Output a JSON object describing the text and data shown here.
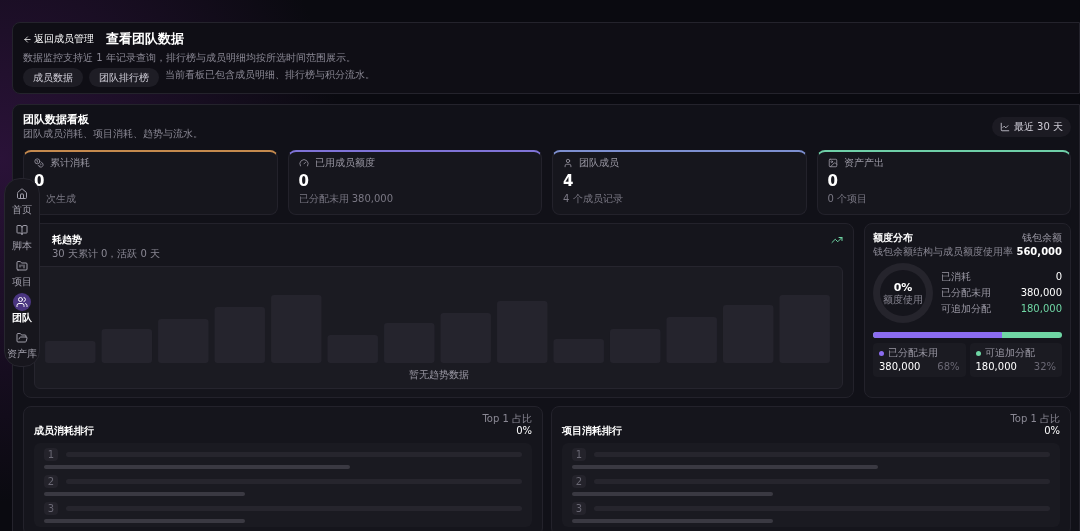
{
  "header": {
    "back_link": "返回成员管理",
    "title": "查看团队数据",
    "description": "数据监控支持近 1 年记录查询，排行榜与成员明细均按所选时间范围展示。",
    "tabs": [
      {
        "label": "成员数据",
        "selected": false
      },
      {
        "label": "团队排行榜",
        "selected": false
      }
    ],
    "note": "当前看板已包含成员明细、排行榜与积分流水。"
  },
  "sidebar": {
    "items": [
      {
        "label": "首页",
        "selected": false
      },
      {
        "label": "脚本",
        "selected": false
      },
      {
        "label": "项目",
        "selected": false
      },
      {
        "label": "团队",
        "selected": true
      },
      {
        "label": "资产库",
        "selected": false
      }
    ]
  },
  "dashboard": {
    "title": "团队数据看板",
    "subtitle": "团队成员消耗、项目消耗、趋势与流水。",
    "range_button": "最近 30 天",
    "stats": [
      {
        "label": "累计消耗",
        "value": "0",
        "detail": "次生成",
        "color": "#c58a4e"
      },
      {
        "label": "已用成员额度",
        "value": "0",
        "detail": "已分配未用 380,000",
        "color": "#7f73d6"
      },
      {
        "label": "团队成员",
        "value": "4",
        "detail": "4 个成员记录",
        "color": "#7d8fd0"
      },
      {
        "label": "资产产出",
        "value": "0",
        "detail": "0 个项目",
        "color": "#6fcfa8"
      }
    ],
    "trend": {
      "title": "耗趋势",
      "subtitle": "30 天累计 0，活跃 0 天",
      "empty": "暂无趋势数据"
    },
    "quota": {
      "title": "额度分布",
      "subtitle": "钱包余额结构与成员额度使用率",
      "wallet_label": "钱包余额",
      "wallet_value": "560,000",
      "donut_value": "0%",
      "donut_label": "额度使用",
      "rows": [
        {
          "label": "已消耗",
          "value": "0",
          "highlight": false
        },
        {
          "label": "已分配未用",
          "value": "380,000",
          "highlight": false
        },
        {
          "label": "可追加分配",
          "value": "180,000",
          "highlight": true
        }
      ],
      "distribution": {
        "level": 0.68
      },
      "legend": [
        {
          "label": "已分配未用",
          "value": "380,000",
          "percent": "68%",
          "color": "#8b6cf0"
        },
        {
          "label": "可追加分配",
          "value": "180,000",
          "percent": "32%",
          "color": "#6fd6a4"
        }
      ]
    }
  },
  "rankings": [
    {
      "title": "成员消耗排行",
      "top_label": "Top 1 占比",
      "top_value": "0%",
      "ranks": [
        "1",
        "2",
        "3"
      ]
    },
    {
      "title": "项目消耗排行",
      "top_label": "Top 1 占比",
      "top_value": "0%",
      "ranks": [
        "1",
        "2",
        "3"
      ]
    }
  ]
}
